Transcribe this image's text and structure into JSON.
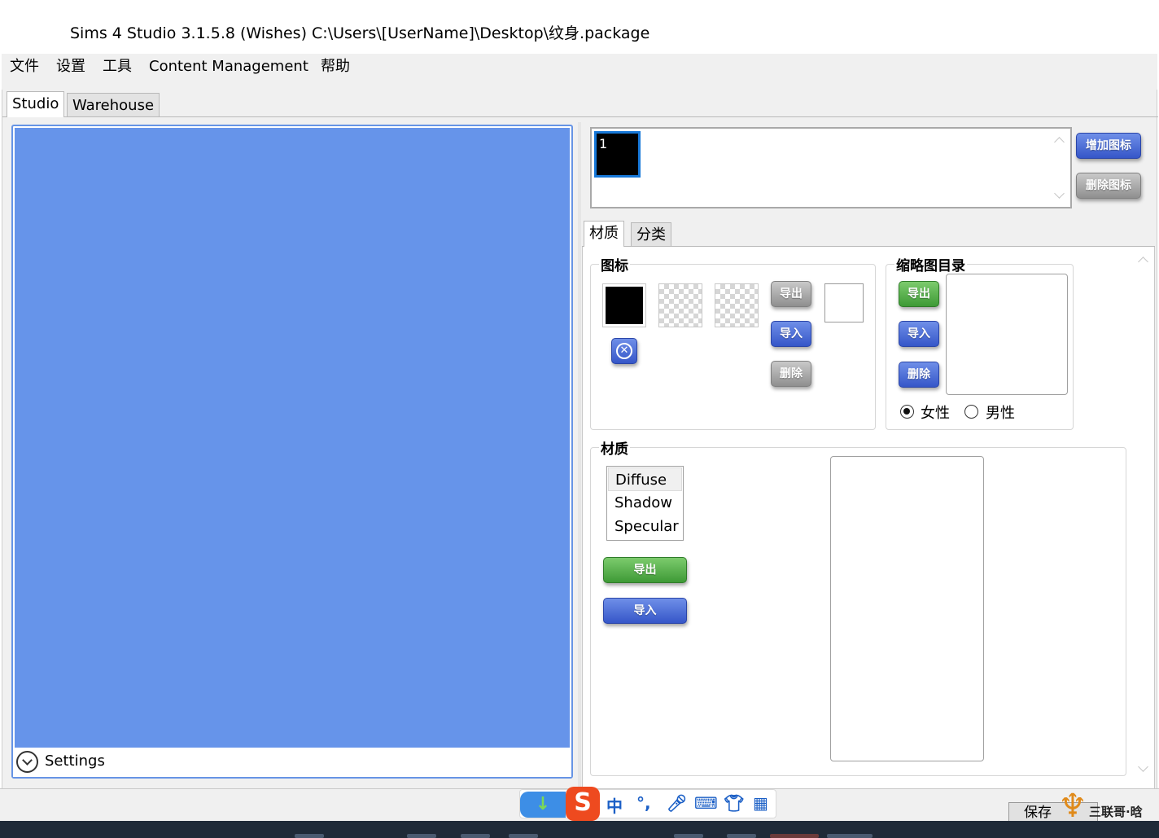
{
  "window": {
    "title": "Sims 4 Studio 3.1.5.8 (Wishes)  C:\\Users\\[UserName]\\Desktop\\纹身.package"
  },
  "menu": [
    "文件",
    "设置",
    "工具",
    "Content Management",
    "帮助"
  ],
  "main_tabs": {
    "studio": "Studio",
    "warehouse": "Warehouse"
  },
  "preview": {
    "settings_label": "Settings"
  },
  "icons_strip": {
    "selected_index_label": "1",
    "add_button": "增加图标",
    "remove_button": "删除图标"
  },
  "sub_tabs": {
    "material": "材质",
    "category": "分类"
  },
  "icon_group": {
    "title": "图标",
    "export": "导出",
    "import": "导入",
    "delete": "删除"
  },
  "thumbnail_group": {
    "title": "缩略图目录",
    "export": "导出",
    "import": "导入",
    "delete": "删除",
    "female": "女性",
    "male": "男性",
    "selected_gender": "女性"
  },
  "texture_group": {
    "title": "材质",
    "types": [
      "Diffuse",
      "Shadow",
      "Specular"
    ],
    "selected_type": "Diffuse",
    "export": "导出",
    "import": "导入"
  },
  "footer": {
    "save": "保存"
  },
  "ime": {
    "mode": "中",
    "punct": "°,"
  },
  "watermark": "三联哥·晗",
  "colors": {
    "viewport": "#6694ea",
    "button_blue": "#3f61d0",
    "button_green": "#4aa83f",
    "button_gray": "#a3a3a3",
    "selection": "#1778d8"
  }
}
